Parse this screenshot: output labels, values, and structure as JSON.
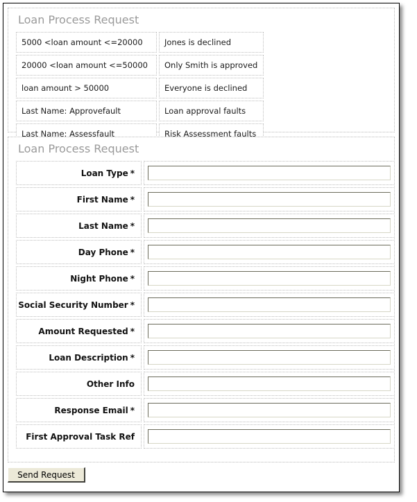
{
  "window": {
    "title": "Loan Process Request"
  },
  "rules_panel": {
    "heading": "Loan Process Request",
    "rules": [
      {
        "condition": "5000 <loan amount <=20000",
        "action": "Jones is declined"
      },
      {
        "condition": "20000 <loan amount <=50000",
        "action": "Only Smith is approved"
      },
      {
        "condition": "loan amount > 50000",
        "action": "Everyone is declined"
      },
      {
        "condition": "Last Name: Approvefault",
        "action": "Loan approval faults"
      },
      {
        "condition": "Last Name: Assessfault",
        "action": "Risk Assessment faults"
      }
    ]
  },
  "form_panel": {
    "heading": "Loan Process Request",
    "required_marker": "*",
    "fields": [
      {
        "label": "Loan Type",
        "required": true,
        "value": "",
        "placeholder": ""
      },
      {
        "label": "First Name",
        "required": true,
        "value": "",
        "placeholder": ""
      },
      {
        "label": "Last Name",
        "required": true,
        "value": "",
        "placeholder": ""
      },
      {
        "label": "Day Phone",
        "required": true,
        "value": "",
        "placeholder": ""
      },
      {
        "label": "Night Phone",
        "required": true,
        "value": "",
        "placeholder": ""
      },
      {
        "label": "Social Security Number",
        "required": true,
        "value": "",
        "placeholder": ""
      },
      {
        "label": "Amount Requested",
        "required": true,
        "value": "",
        "placeholder": ""
      },
      {
        "label": "Loan Description",
        "required": true,
        "value": "",
        "placeholder": ""
      },
      {
        "label": "Other Info",
        "required": false,
        "value": "",
        "placeholder": ""
      },
      {
        "label": "Response Email",
        "required": true,
        "value": "",
        "placeholder": ""
      },
      {
        "label": "First Approval Task Ref",
        "required": false,
        "value": "",
        "placeholder": ""
      }
    ]
  },
  "footer": {
    "send_label": "Send Request"
  },
  "colors": {
    "heading_gray": "#9a9a9a",
    "dotted_border": "#bdbdbd",
    "window_border": "#000000",
    "button_face": "#ece9d8",
    "text": "#111111"
  }
}
